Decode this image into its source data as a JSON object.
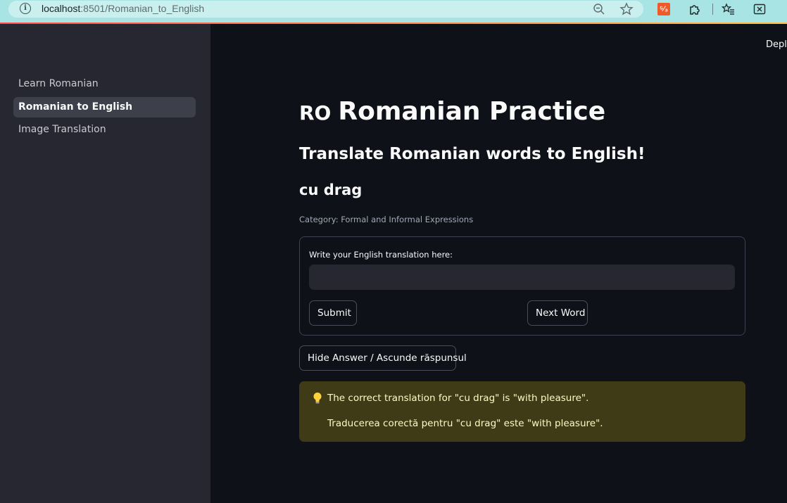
{
  "browser": {
    "url_host": "localhost",
    "url_rest": ":8501/Romanian_to_English",
    "ext_label": "⁵⁄₃"
  },
  "sidebar": {
    "items": [
      {
        "label": "Learn Romanian"
      },
      {
        "label": "Romanian to English"
      },
      {
        "label": "Image Translation"
      }
    ],
    "active_index": 1
  },
  "header": {
    "deploy_label": "Deploy"
  },
  "main": {
    "flag_label": "RO",
    "title": "Romanian Practice",
    "subtitle": "Translate Romanian words to English!",
    "word": "cu drag",
    "category": "Category: Formal and Informal Expressions",
    "form": {
      "input_label": "Write your English translation here:",
      "input_value": "",
      "input_placeholder": "",
      "submit_label": "Submit",
      "next_label": "Next Word"
    },
    "hide_label": "Hide Answer / Ascunde răspunsul",
    "answer": {
      "line1": "The correct translation for \"cu drag\" is \"with pleasure\".",
      "line2": "Traducerea corectă pentru \"cu drag\" este \"with pleasure\"."
    }
  },
  "colors": {
    "background": "#0e1117",
    "sidebar": "#262730",
    "answer_bg": "#3e3b16",
    "answer_text": "#fff9c4",
    "accent": "#ff4b4b"
  }
}
